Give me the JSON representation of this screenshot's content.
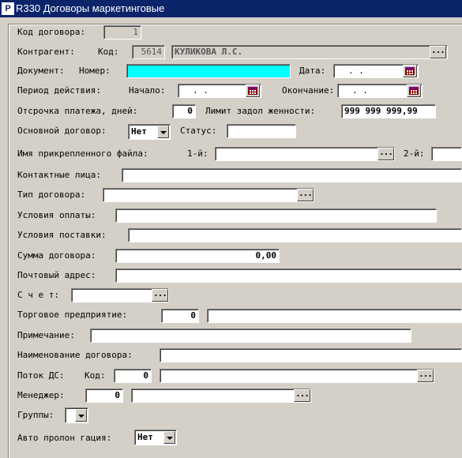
{
  "window": {
    "icon_text": "P",
    "title": "R330 Договоры маркетинговые"
  },
  "form": {
    "contract_code_label": "Код договора:",
    "contract_code_value": "1",
    "counterparty_label": "Контрагент:",
    "counterparty_code_label": "Код:",
    "counterparty_code_value": "5614",
    "counterparty_name_value": "КУЛИКОВА Л.С.",
    "document_label": "Документ:",
    "number_label": "Номер:",
    "number_value": "",
    "date_label": "Дата:",
    "date_value": ".  .",
    "period_label": "Период действия:",
    "start_label": "Начало:",
    "start_value": ".  .",
    "end_label": "Окончание:",
    "end_value": ".  .",
    "deferral_label": "Отсрочка  платежа, дней:",
    "deferral_value": "0",
    "debt_limit_label": "Лимит задол женности:",
    "debt_limit_value": "999 999 999,99",
    "main_contract_label": "Основной договор:",
    "main_contract_value": "Нет",
    "status_label": "Статус:",
    "status_value": "",
    "attached_file_label": "Имя прикрепленного файла:",
    "file1_label": "1-й:",
    "file2_label": "2-й:",
    "contacts_label": "Контактные лица:",
    "contract_type_label": "Тип договора:",
    "payment_terms_label": "Условия оплаты:",
    "delivery_terms_label": "Условия поставки:",
    "amount_label": "Сумма договора:",
    "amount_value": "0,00",
    "postal_address_label": "Почтовый адрес:",
    "account_label": "С ч е т:",
    "trade_enterprise_label": "Торговое предприятие:",
    "trade_enterprise_value": "0",
    "note_label": "Примечание:",
    "contract_name_label": "Наименование договора:",
    "cash_flow_label": "Поток ДС:",
    "cash_flow_code_label": "Код:",
    "cash_flow_code_value": "0",
    "manager_label": "Менеджер:",
    "manager_value": "0",
    "groups_label": "Группы:",
    "auto_prolong_label": "Авто пролон гация:",
    "auto_prolong_value": "Нет",
    "ellipsis": "..."
  },
  "icons": [
    "app-icon",
    "ellipsis-icon",
    "calendar-icon",
    "chevron-down-icon"
  ]
}
